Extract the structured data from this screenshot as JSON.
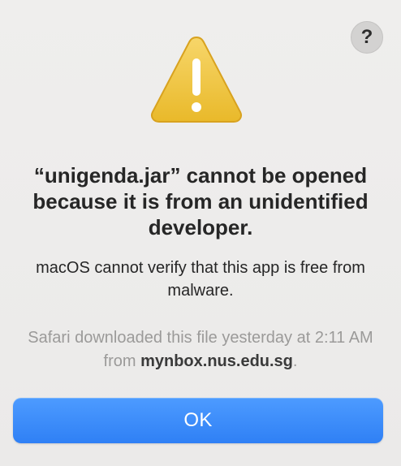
{
  "dialog": {
    "help_icon": "question-mark-icon",
    "help_glyph": "?",
    "warning_icon": "warning-triangle-icon",
    "title": "“unigenda.jar” cannot be opened because it is from an unidentified developer.",
    "message": "macOS cannot verify that this app is free from malware.",
    "info_prefix": "Safari downloaded this file yesterday at 2:11 AM from ",
    "info_host": "mynbox.nus.edu.sg",
    "info_suffix": ".",
    "ok_label": "OK"
  },
  "colors": {
    "accent": "#3a8bff",
    "warning_fill": "#f1c232",
    "background": "#ecebea"
  }
}
